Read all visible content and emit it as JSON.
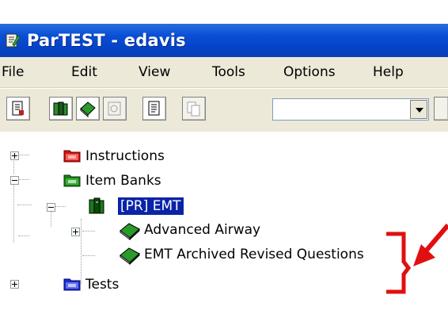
{
  "window": {
    "title": "ParTEST - edavis",
    "app_icon": "partest-app-icon"
  },
  "menu": [
    "File",
    "Edit",
    "View",
    "Tools",
    "Options",
    "Help"
  ],
  "toolbar": {
    "buttons": [
      {
        "icon": "new-document-icon",
        "enabled": true
      },
      {
        "icon": "item-bank-icon",
        "enabled": true
      },
      {
        "icon": "book-icon",
        "enabled": true
      },
      {
        "icon": "report-icon",
        "enabled": false
      },
      {
        "icon": "page-icon",
        "enabled": true
      },
      {
        "icon": "copy-pages-icon",
        "enabled": false
      }
    ],
    "combo_value": ""
  },
  "tree": {
    "nodes": [
      {
        "label": "Instructions",
        "icon": "red-folder-icon",
        "expander": "plus"
      },
      {
        "label": "Item Banks",
        "icon": "green-folder-icon",
        "expander": "minus"
      },
      {
        "label": "[PR] EMT",
        "icon": "bank-books-icon",
        "expander": "minus",
        "selected": true
      },
      {
        "label": "Advanced Airway",
        "icon": "green-book-icon",
        "expander": "plus"
      },
      {
        "label": "EMT Archived Revised Questions",
        "icon": "green-book-icon",
        "expander": "none"
      },
      {
        "label": "Tests",
        "icon": "blue-folder-icon",
        "expander": "plus"
      }
    ]
  },
  "colors": {
    "titlebar": "#0a4fd6",
    "menubar": "#ece9d8",
    "selection": "#0a24a8",
    "annotation": "#e01010"
  }
}
